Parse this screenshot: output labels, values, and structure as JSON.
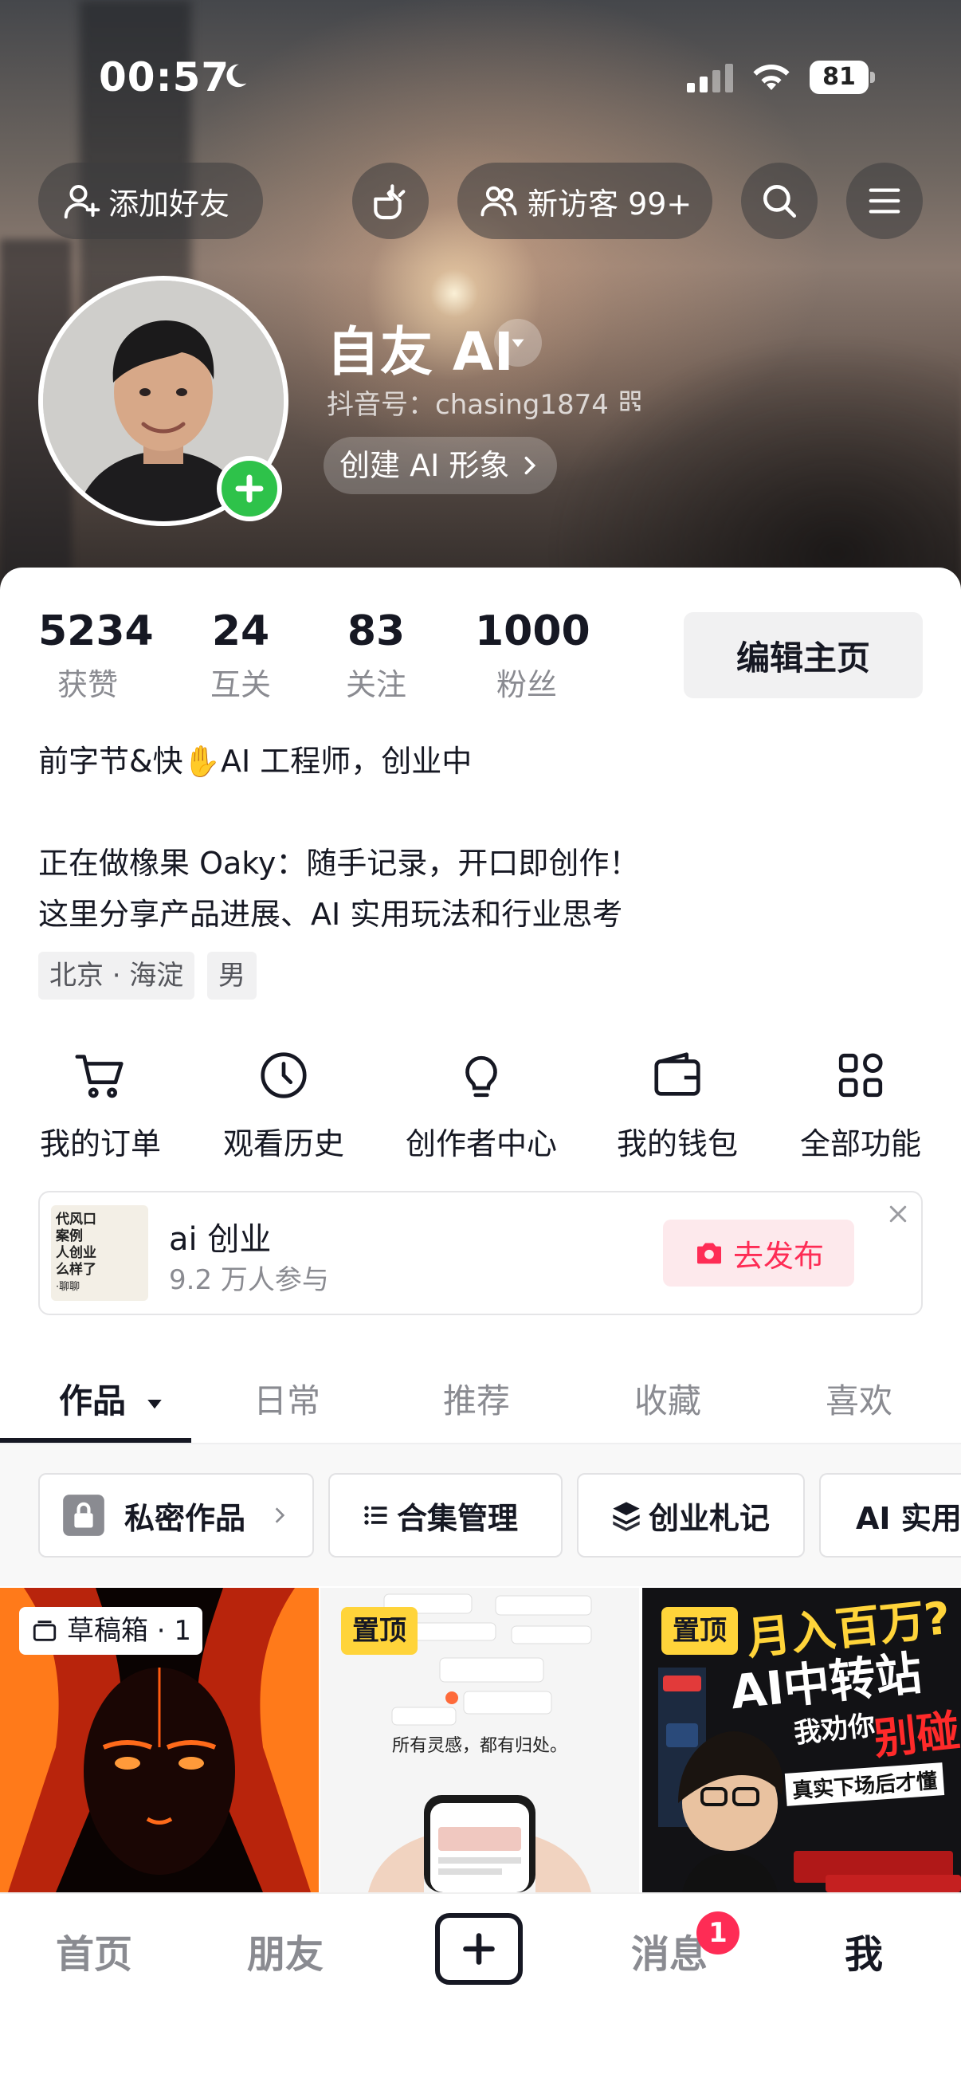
{
  "status_bar": {
    "time": "00:57",
    "battery": "81"
  },
  "header": {
    "add_friend_label": "添加好友",
    "visitors_label": "新访客 99+"
  },
  "profile": {
    "name": "自友 AI",
    "douyin_id": "抖音号：chasing1874",
    "create_ai_label": "创建 AI 形象"
  },
  "stats": [
    {
      "value": "5234",
      "label": "获赞"
    },
    {
      "value": "24",
      "label": "互关"
    },
    {
      "value": "83",
      "label": "关注"
    },
    {
      "value": "1000",
      "label": "粉丝"
    }
  ],
  "edit_profile_label": "编辑主页",
  "bio": {
    "line1": "前字节&快✋AI 工程师，创业中",
    "line2": "正在做橡果 Oaky：随手记录，开口即创作！",
    "line3": "这里分享产品进展、AI 实用玩法和行业思考"
  },
  "tags": [
    "北京 · 海淀",
    "男"
  ],
  "quick_actions": [
    {
      "label": "我的订单",
      "icon": "cart-icon"
    },
    {
      "label": "观看历史",
      "icon": "clock-icon"
    },
    {
      "label": "创作者中心",
      "icon": "lightbulb-icon"
    },
    {
      "label": "我的钱包",
      "icon": "wallet-icon"
    },
    {
      "label": "全部功能",
      "icon": "grid-icon"
    }
  ],
  "banner": {
    "title": "ai 创业",
    "subtitle": "9.2 万人参与",
    "button_label": "去发布",
    "thumb_lines": [
      "代风口",
      "案例",
      "人创业",
      "么样了",
      "·聊聊"
    ]
  },
  "tabs": [
    "作品",
    "日常",
    "推荐",
    "收藏",
    "喜欢"
  ],
  "chips": [
    "私密作品",
    "合集管理",
    "创业札记",
    "AI 实用"
  ],
  "grid": {
    "draft_label": "草稿箱 · 1",
    "pinned_label": "置顶",
    "video2_caption": "所有灵感，都有归处。",
    "video3_headline1": "月入百万?",
    "video3_headline2": "AI中转站",
    "video3_headline3": "我劝你",
    "video3_headline4": "别碰",
    "video3_footer": "真实下场后才懂"
  },
  "nav": {
    "home": "首页",
    "friends": "朋友",
    "messages": "消息",
    "messages_badge": "1",
    "me": "我"
  },
  "colors": {
    "accent": "#fe2c55",
    "online": "#2ec24a",
    "pin": "#ffd43a"
  }
}
